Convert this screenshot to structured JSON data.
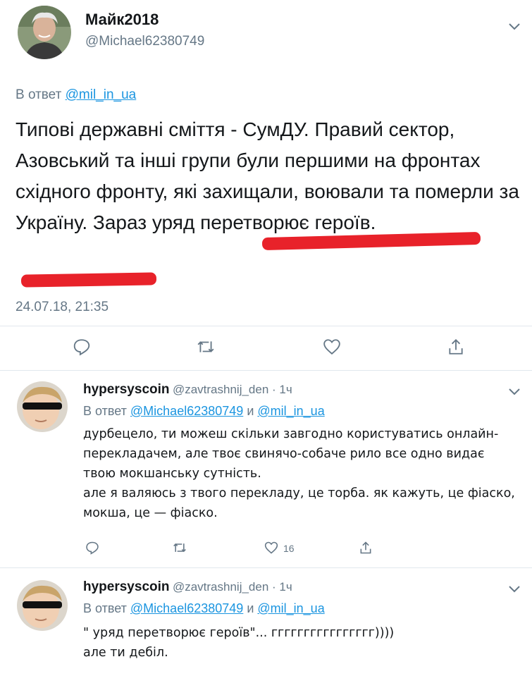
{
  "main_tweet": {
    "display_name": "Майк2018",
    "handle": "@Michael62380749",
    "reply_prefix": "В ответ",
    "reply_to": "@mil_in_ua",
    "text": "Типові державні сміття - СумДУ. Правий сектор, Азовський та інші групи були першими на фронтах східного фронту, які захищали, воювали та померли за Україну. Зараз уряд перетворює героїв.",
    "timestamp": "24.07.18, 21:35",
    "icons": [
      "reply-icon",
      "retweet-icon",
      "like-icon",
      "share-icon"
    ],
    "annotation_color": "#e8222a"
  },
  "replies": [
    {
      "display_name": "hypersyscoin",
      "meta": "@zavtrashnij_den · 1ч",
      "reply_prefix": "В ответ",
      "mention_1": "@Michael62380749",
      "conj": "и",
      "mention_2": "@mil_in_ua",
      "text": "дурбецело, ти можеш скільки завгодно користуватись онлайн-перекладачем, але твоє свинячо-собаче рило все одно видає твою мокшанську сутність.\nале я валяюсь з твого перекладу, це торба. як кажуть, це фіаско, мокша, це — фіаско.",
      "like_count": "16"
    },
    {
      "display_name": "hypersyscoin",
      "meta": "@zavtrashnij_den · 1ч",
      "reply_prefix": "В ответ",
      "mention_1": "@Michael62380749",
      "conj": "и",
      "mention_2": "@mil_in_ua",
      "text": "\" уряд перетворює героїв\"... гггггггггггггггг))))\nале ти дебіл."
    }
  ],
  "colors": {
    "link": "#1b95e0",
    "secondary": "#657786",
    "divider": "#e1e8ed"
  }
}
